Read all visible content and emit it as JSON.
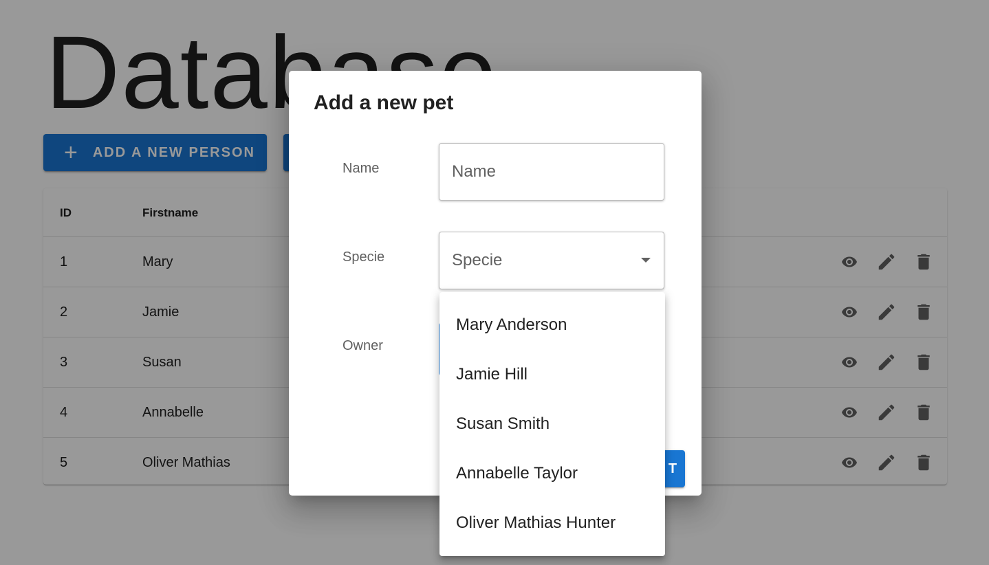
{
  "page": {
    "title": "Database",
    "add_person_label": "ADD A NEW PERSON",
    "add_pet_label": ""
  },
  "table": {
    "columns": [
      "ID",
      "Firstname"
    ],
    "rows": [
      {
        "id": "1",
        "firstname": "Mary"
      },
      {
        "id": "2",
        "firstname": "Jamie"
      },
      {
        "id": "3",
        "firstname": "Susan"
      },
      {
        "id": "4",
        "firstname": "Annabelle"
      },
      {
        "id": "5",
        "firstname": "Oliver Mathias"
      }
    ],
    "row_actions": [
      "view-icon",
      "edit-icon",
      "delete-icon"
    ]
  },
  "dialog": {
    "title": "Add a new pet",
    "name_label": "Name",
    "name_placeholder": "Name",
    "specie_label": "Specie",
    "specie_value": "Specie",
    "owner_label": "Owner",
    "submit_label": "T"
  },
  "owner_options": [
    "Mary Anderson",
    "Jamie Hill",
    "Susan Smith",
    "Annabelle Taylor",
    "Oliver Mathias Hunter"
  ],
  "colors": {
    "primary": "#1976d2",
    "icon": "#616161",
    "backdrop": "rgba(0,0,0,0.4)"
  }
}
